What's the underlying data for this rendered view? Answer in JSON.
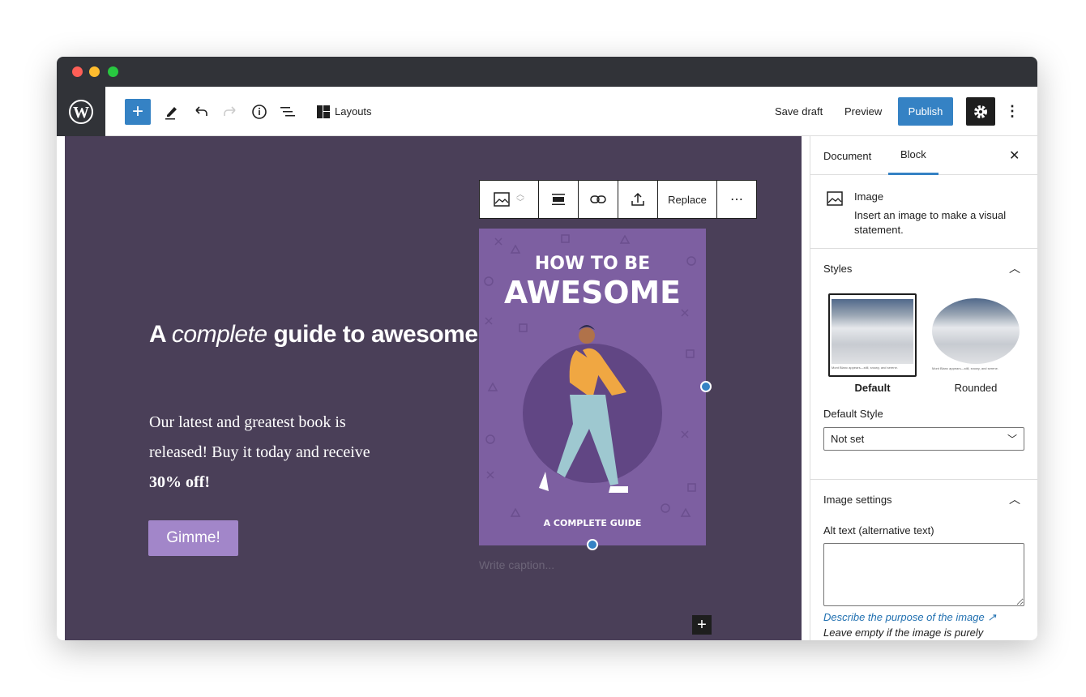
{
  "toolbar": {
    "layouts": "Layouts",
    "save_draft": "Save draft",
    "preview": "Preview",
    "publish": "Publish"
  },
  "content": {
    "heading_a": "A ",
    "heading_em": "complete",
    "heading_b": " guide to awesomeness.",
    "para": "Our latest and greatest book is released! Buy it today and receive ",
    "para_bold": "30% off!",
    "button": "Gimme!",
    "caption_placeholder": "Write caption...",
    "cover_title_1": "HOW TO BE",
    "cover_title_2": "AWESOME",
    "cover_subtitle": "A COMPLETE GUIDE"
  },
  "block_toolbar": {
    "replace": "Replace"
  },
  "sidebar": {
    "tabs": [
      "Document",
      "Block"
    ],
    "block_name": "Image",
    "block_desc": "Insert an image to make a visual statement.",
    "styles_title": "Styles",
    "styles": [
      "Default",
      "Rounded"
    ],
    "style_caption": "Mont Blanc appears—still, snowy, and serene.",
    "default_style_label": "Default Style",
    "default_style_value": "Not set",
    "image_settings_title": "Image settings",
    "alt_label": "Alt text (alternative text)",
    "alt_value": "",
    "alt_link": "Describe the purpose of the image",
    "alt_help": "Leave empty if the image is purely"
  },
  "colors": {
    "accent": "#3582c4",
    "canvas": "#4a3f58",
    "button": "#a286c9",
    "cover": "#7d5fa1"
  }
}
